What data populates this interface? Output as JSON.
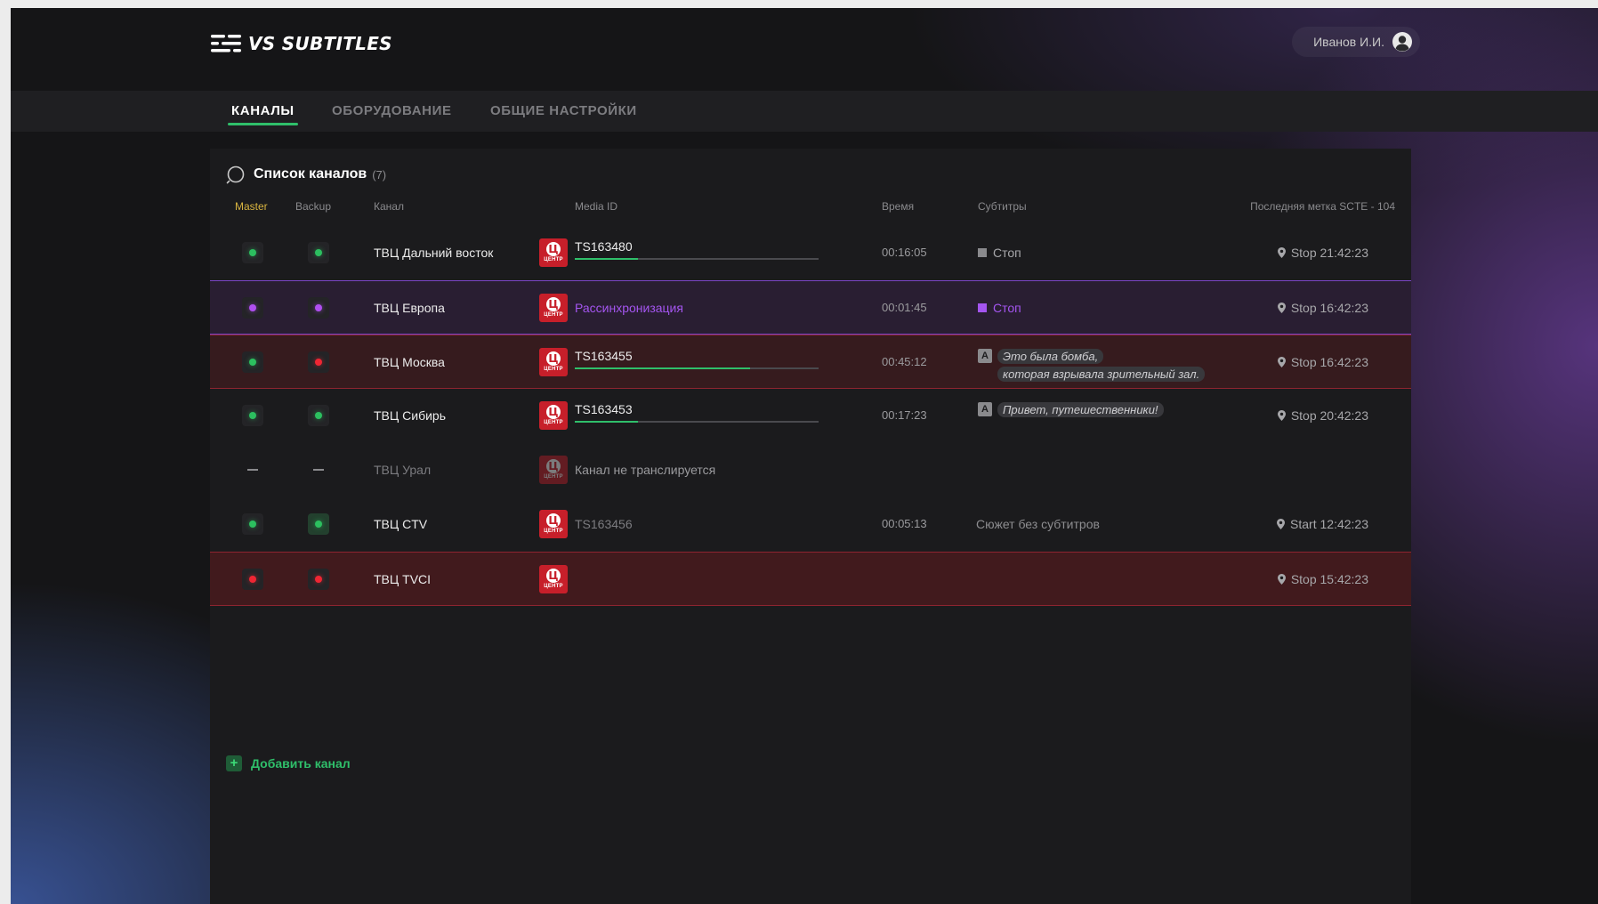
{
  "app": {
    "name": "VS SUBTITLES",
    "user_name": "Иванов И.И."
  },
  "nav": {
    "tabs": [
      {
        "label": "КАНАЛЫ",
        "active": true
      },
      {
        "label": "ОБОРУДОВАНИЕ",
        "active": false
      },
      {
        "label": "ОБЩИЕ НАСТРОЙКИ",
        "active": false
      }
    ]
  },
  "panel": {
    "title": "Список каналов",
    "count": "(7)",
    "columns": {
      "master": "Master",
      "backup": "Backup",
      "channel": "Канал",
      "media_id": "Media ID",
      "time": "Время",
      "subtitles": "Субтитры",
      "scte": "Последняя метка SCTE - 104"
    },
    "channel_logo_sub": "ЦЕНТР",
    "channel_logo_glyph": "Ц",
    "add_label": "Добавить канал"
  },
  "rows": [
    {
      "name": "ТВЦ Дальний восток",
      "master": "green",
      "backup": "green",
      "media_id": "TS163480",
      "progress": 0.26,
      "time": "00:16:05",
      "subtitles_status": "Стоп",
      "scte": "Stop 21:42:23"
    },
    {
      "name": "ТВЦ Европа",
      "master": "purple",
      "backup": "purple",
      "media_id": "Рассинхронизация",
      "time": "00:01:45",
      "subtitles_status": "Стоп",
      "scte": "Stop 16:42:23"
    },
    {
      "name": "ТВЦ Москва",
      "master": "green",
      "backup": "red",
      "media_id": "TS163455",
      "progress": 0.72,
      "time": "00:45:12",
      "subtitle_lines": [
        "Это была бомба,",
        "которая взрывала зрительный зал."
      ],
      "scte": "Stop 16:42:23"
    },
    {
      "name": "ТВЦ Сибирь",
      "master": "green",
      "backup": "green",
      "media_id": "TS163453",
      "progress": 0.26,
      "time": "00:17:23",
      "subtitle_lines": [
        "Привет, путешественники!"
      ],
      "scte": "Stop 20:42:23"
    },
    {
      "name": "ТВЦ Урал",
      "master": "none",
      "backup": "none",
      "media_id": "Канал не транслируется"
    },
    {
      "name": "ТВЦ CTV",
      "master": "green",
      "backup": "green",
      "media_id": "TS163456",
      "time": "00:05:13",
      "subtitles_text": "Сюжет без субтитров",
      "scte": "Start 12:42:23"
    },
    {
      "name": "ТВЦ TVCI",
      "master": "red",
      "backup": "red",
      "scte": "Stop 15:42:23"
    }
  ],
  "colors": {
    "accent_green": "#2fbf6a",
    "sync_purple": "#a455f0",
    "alarm_red": "#ee2633",
    "master_header": "#d8b440"
  },
  "icons": {
    "logo": "subtitles-lines-icon",
    "user": "user-avatar-icon",
    "search": "search-icon",
    "scte": "location-pin-icon",
    "add": "plus-icon"
  }
}
